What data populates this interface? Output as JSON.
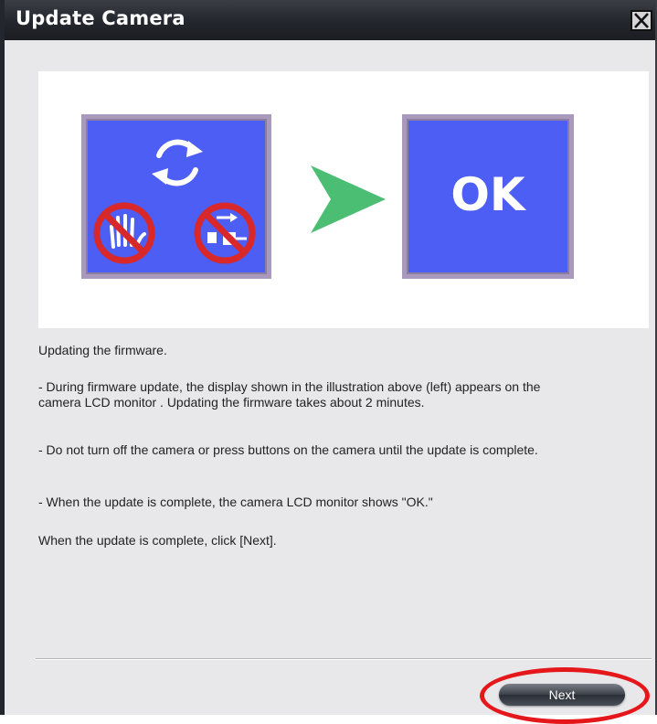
{
  "window": {
    "title": "Update Camera"
  },
  "illustration": {
    "ok_label": "OK",
    "colors": {
      "screen_blue": "#4c5ef4",
      "arrow_green": "#4cbe74",
      "prohibit_red": "#d8282a"
    }
  },
  "content": {
    "intro": "Updating the firmware.",
    "bullets": [
      "- During firmware update, the display shown in the illustration above (left) appears on the camera LCD monitor . Updating the firmware takes about 2 minutes.",
      "- Do not turn off  the camera or press buttons on the camera until the update is complete.",
      "- When the update is complete, the camera LCD monitor shows \"OK.\""
    ],
    "outro": "When the update is complete, click [Next]."
  },
  "buttons": {
    "next_label": "Next"
  },
  "icons": [
    "close-icon",
    "rotate-arrows-icon",
    "no-hand-icon",
    "no-cable-icon",
    "green-arrow-icon"
  ]
}
